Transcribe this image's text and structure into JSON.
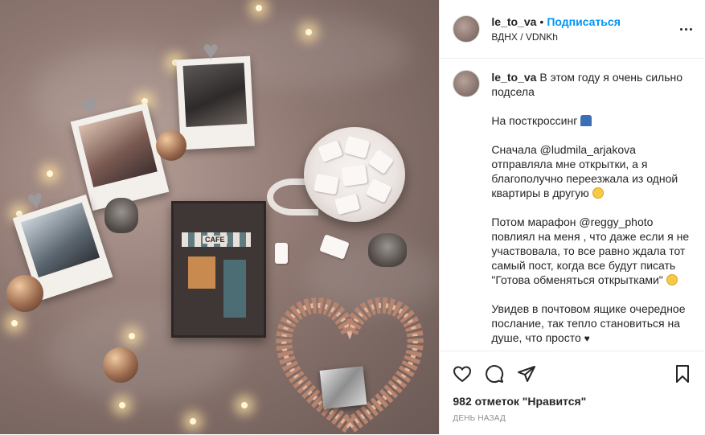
{
  "post": {
    "photo_alt": "",
    "card_sign": "CAFE",
    "header": {
      "username": "le_to_va",
      "separator": "•",
      "follow_label": "Подписаться",
      "location": "ВДНХ / VDNKh"
    },
    "caption": {
      "username": "le_to_va",
      "paragraphs": [
        "В этом году я очень сильно подсела",
        "На посткроссинг",
        "Сначала @ludmila_arjakova отправляла мне открытки, а я благополучно переезжала из одной квартиры в другую",
        "Потом марафон @reggy_photo повлиял на меня , что даже если я не участвовала, то все равно ждала тот самый пост, когда все будут писать \"Готова обменяться открытками\"",
        "Увидев в почтовом ящике очередное послание, так тепло становиться на душе, что просто"
      ]
    },
    "likes": "982 отметок \"Нравится\"",
    "time": "ДЕНЬ НАЗАД",
    "icons": {
      "more": "more-icon",
      "like": "heart-icon",
      "comment": "comment-icon",
      "share": "share-icon",
      "save": "bookmark-icon"
    }
  }
}
